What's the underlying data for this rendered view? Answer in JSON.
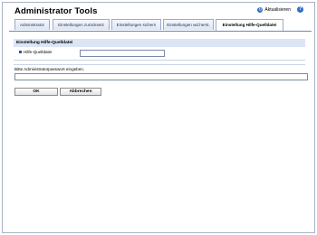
{
  "header": {
    "title": "Administrator Tools",
    "update_label": "Aktualisieren",
    "help_icon": "help-icon",
    "update_icon": "refresh-icon"
  },
  "tabs": [
    {
      "label": "Administrator",
      "active": false
    },
    {
      "label": "Einstellungen zurücksetz",
      "active": false
    },
    {
      "label": "Einstellungen sichern",
      "active": false
    },
    {
      "label": "Einstellungen wd.herst.",
      "active": false
    },
    {
      "label": "Einstellung Hilfe-Quelldatei",
      "active": true
    }
  ],
  "section": {
    "title": "Einstellung Hilfe-Quelldatei",
    "field_label": "Hilfe-Quelldatei",
    "field_value": ""
  },
  "password": {
    "prompt": "Bitte Administratorpasswort eingeben.",
    "value": ""
  },
  "buttons": {
    "ok_label": "OK",
    "cancel_label": "Abbrechen"
  },
  "colors": {
    "accent": "#2f6ec2",
    "section_header_bg": "#dbe5f4"
  }
}
